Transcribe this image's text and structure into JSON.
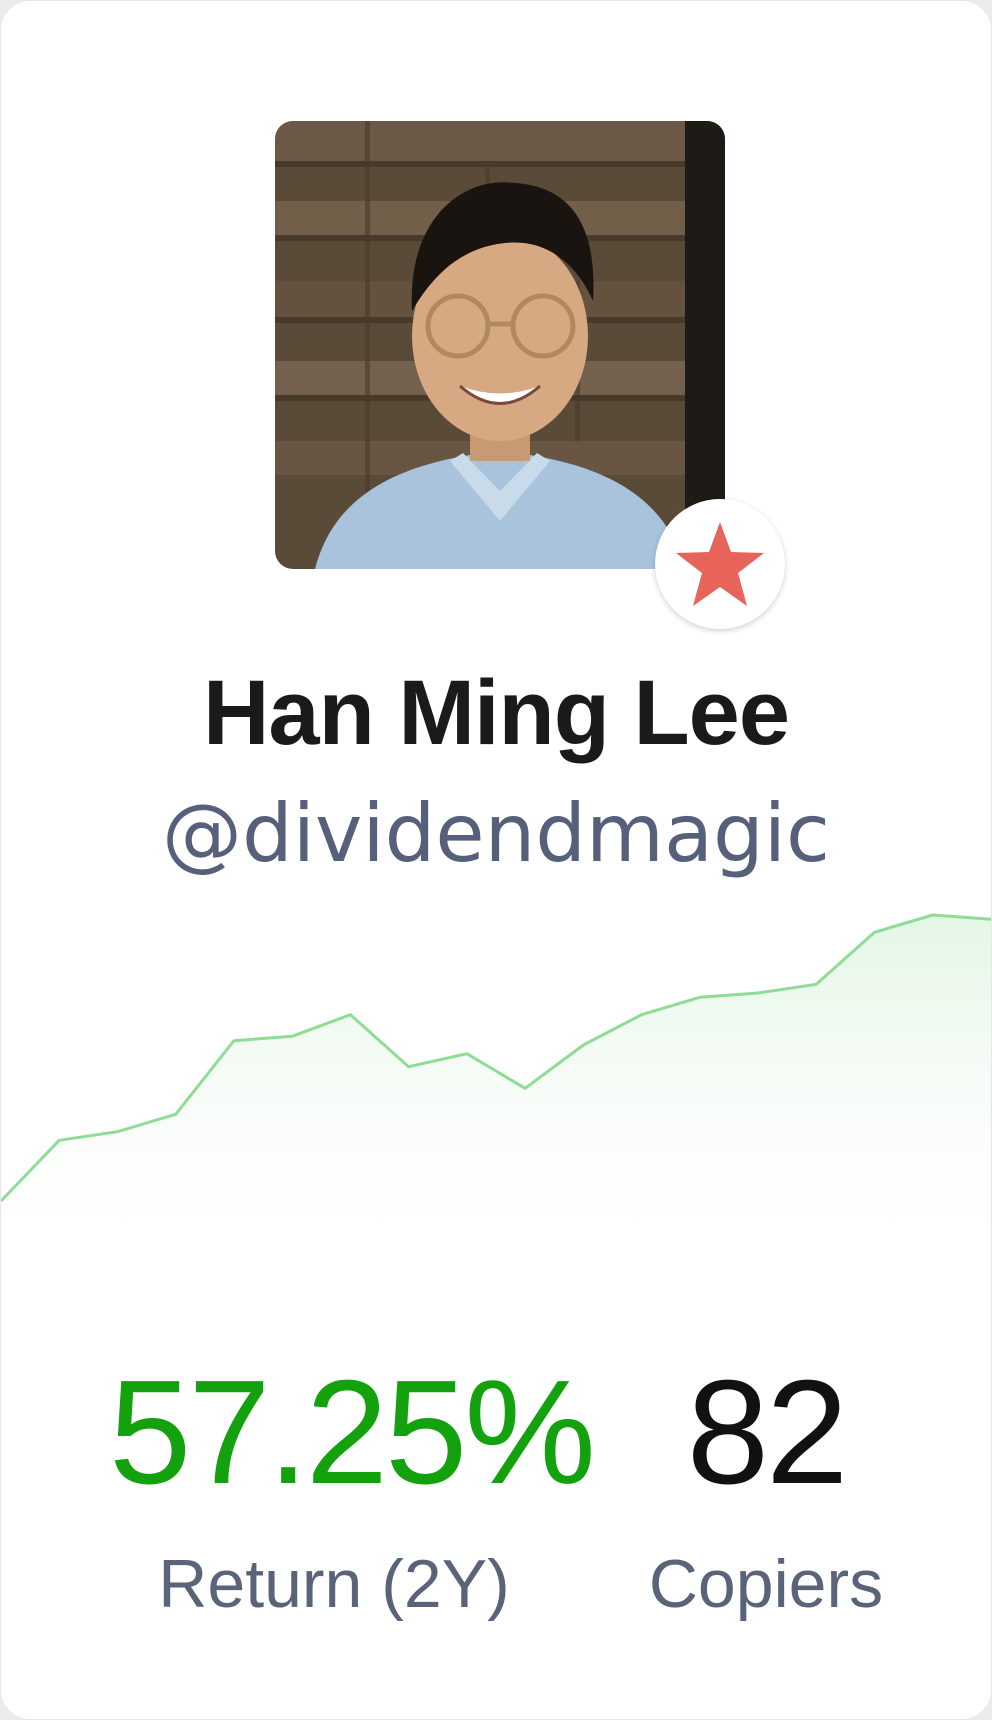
{
  "trader": {
    "name": "Han Ming Lee",
    "handle": "@dividendmagic"
  },
  "icons": {
    "badge": "star-icon"
  },
  "colors": {
    "return_positive": "#13a10e",
    "chart_line": "#8fdc95",
    "badge_star": "#e8635a"
  },
  "chart_data": {
    "type": "area",
    "values": [
      10,
      24,
      26,
      30,
      47,
      48,
      53,
      41,
      44,
      36,
      46,
      53,
      57,
      58,
      60,
      72,
      76,
      75
    ]
  },
  "stats": {
    "return": {
      "value": "57.25%",
      "label": "Return (2Y)"
    },
    "copiers": {
      "value": "82",
      "label": "Copiers"
    }
  }
}
